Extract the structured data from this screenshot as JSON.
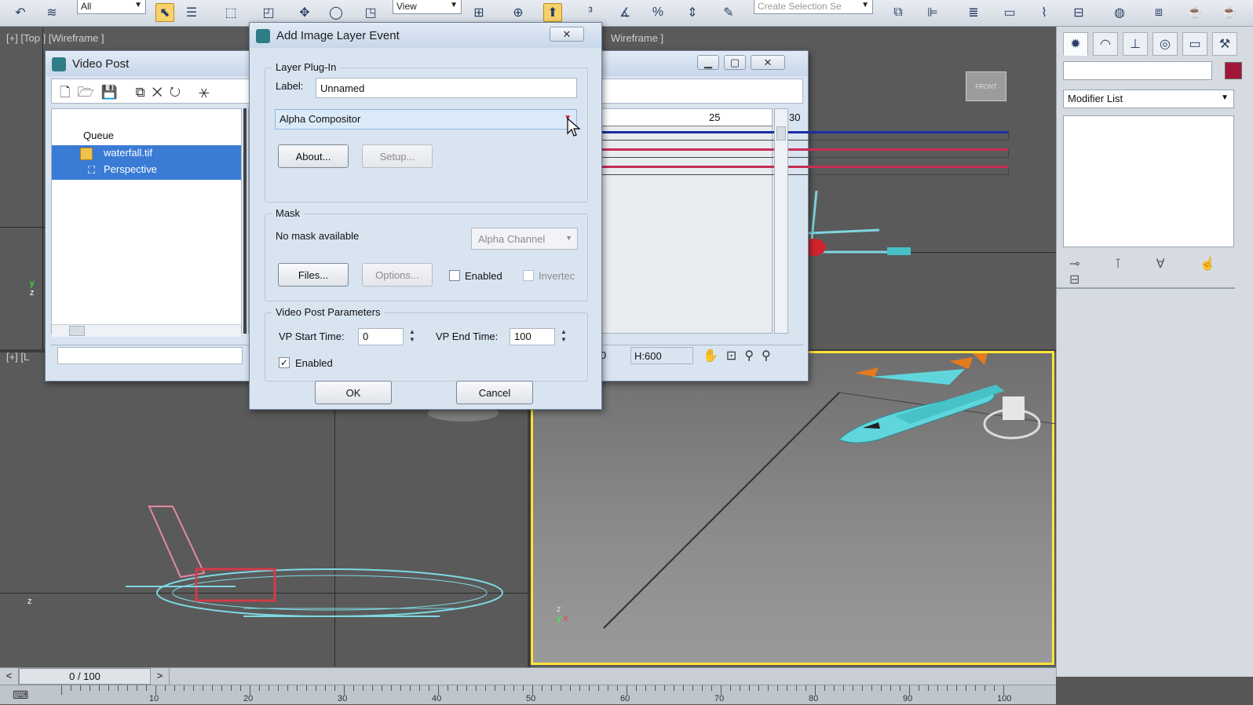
{
  "toolbar": {
    "selection_filter": "All",
    "reference_coord": "View",
    "named_selection_placeholder": "Create Selection Se"
  },
  "viewports": {
    "top_label": "[+] [Top ] [Wireframe ]",
    "front_label_partial": "Wireframe ]",
    "left_label_partial": "[+] [L",
    "viewcube_face": "FRONT"
  },
  "video_post": {
    "title": "Video Post",
    "queue_label": "Queue",
    "queue_items": [
      "waterfall.tif",
      "Perspective"
    ],
    "timeline_ticks": [
      "25",
      "30"
    ],
    "status_partial": "0",
    "status_height": "H:600"
  },
  "dialog": {
    "title": "Add Image Layer Event",
    "layer_plugin_group": "Layer Plug-In",
    "label_caption": "Label:",
    "label_value": "Unnamed",
    "plugin_selected": "Alpha Compositor",
    "about_button": "About...",
    "setup_button": "Setup...",
    "mask_group": "Mask",
    "no_mask_text": "No mask available",
    "mask_channel": "Alpha Channel",
    "files_button": "Files...",
    "options_button": "Options...",
    "mask_enabled_label": "Enabled",
    "inverted_label": "Invertec",
    "vp_params_group": "Video Post Parameters",
    "vp_start_label": "VP Start Time:",
    "vp_start_value": "0",
    "vp_end_label": "VP End Time:",
    "vp_end_value": "100",
    "vp_enabled_label": "Enabled",
    "ok_button": "OK",
    "cancel_button": "Cancel"
  },
  "command_panel": {
    "modifier_list": "Modifier List"
  },
  "time_slider": {
    "frame_readout": "0 / 100",
    "ruler_ticks": [
      "10",
      "20",
      "30",
      "40",
      "50",
      "60",
      "70",
      "80",
      "90",
      "100"
    ]
  },
  "colors": {
    "selection_blue": "#3a7bd5",
    "viewport_active_border": "#ffe33b",
    "object_color_swatch": "#a31736"
  }
}
